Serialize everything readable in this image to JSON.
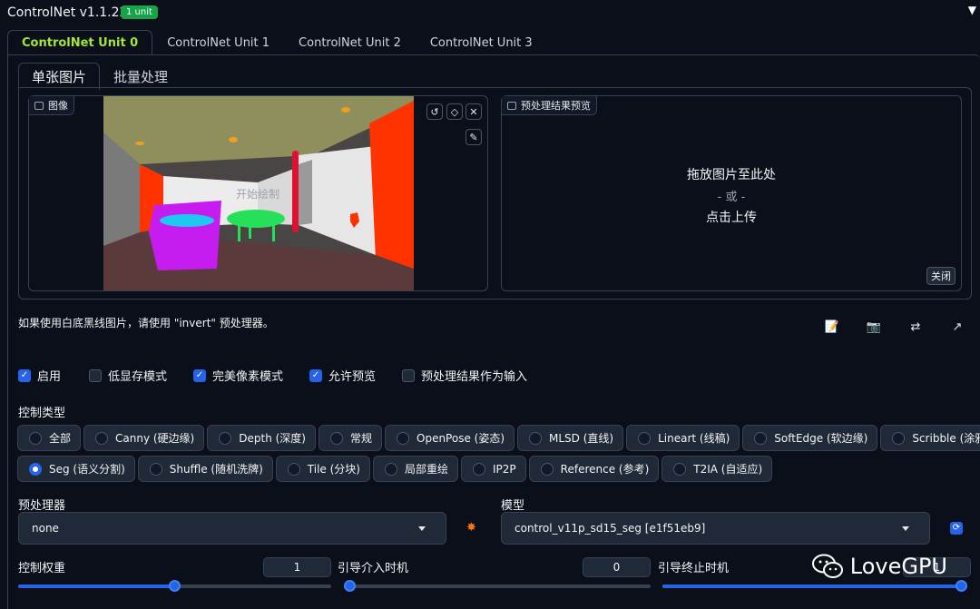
{
  "header": {
    "title": "ControlNet v1.1.227",
    "badge": "1 unit"
  },
  "unit_tabs": [
    {
      "label": "ControlNet Unit 0",
      "active": true
    },
    {
      "label": "ControlNet Unit 1",
      "active": false
    },
    {
      "label": "ControlNet Unit 2",
      "active": false
    },
    {
      "label": "ControlNet Unit 3",
      "active": false
    }
  ],
  "image_tabs": [
    {
      "label": "单张图片",
      "active": true
    },
    {
      "label": "批量处理",
      "active": false
    }
  ],
  "image_block": {
    "label": "图像",
    "canvas_text": "开始绘制"
  },
  "preview_block": {
    "label": "预处理结果预览",
    "drop_text": "拖放图片至此处",
    "or_text": "- 或 -",
    "upload_text": "点击上传",
    "close_label": "关闭"
  },
  "hint": "如果使用白底黑线图片，请使用 \"invert\" 预处理器。",
  "checkboxes": [
    {
      "label": "启用",
      "checked": true
    },
    {
      "label": "低显存模式",
      "checked": false
    },
    {
      "label": "完美像素模式",
      "checked": true
    },
    {
      "label": "允许预览",
      "checked": true
    },
    {
      "label": "预处理结果作为输入",
      "checked": false
    }
  ],
  "control_type": {
    "label": "控制类型",
    "row1": [
      "全部",
      "Canny (硬边缘)",
      "Depth (深度)",
      "常规",
      "OpenPose (姿态)",
      "MLSD (直线)",
      "Lineart (线稿)",
      "SoftEdge (软边缘)",
      "Scribble (涂鸦)"
    ],
    "row2": [
      "Seg (语义分割)",
      "Shuffle (随机洗牌)",
      "Tile (分块)",
      "局部重绘",
      "IP2P",
      "Reference (参考)",
      "T2IA (自适应)"
    ],
    "selected": "Seg (语义分割)"
  },
  "preprocessor": {
    "label": "预处理器",
    "value": "none"
  },
  "model": {
    "label": "模型",
    "value": "control_v11p_sd15_seg [e1f51eb9]"
  },
  "sliders": {
    "weight": {
      "label": "控制权重",
      "value": "1",
      "fraction": 0.5
    },
    "start": {
      "label": "引导介入时机",
      "value": "0",
      "fraction": 0.0
    },
    "end": {
      "label": "引导终止时机",
      "value": "1",
      "fraction": 1.0
    }
  },
  "watermark": "LoveGPU",
  "colors": {
    "accent": "#2563eb",
    "active_tab": "#a3e635",
    "badge": "#16a34a",
    "background": "#0b0f19"
  }
}
